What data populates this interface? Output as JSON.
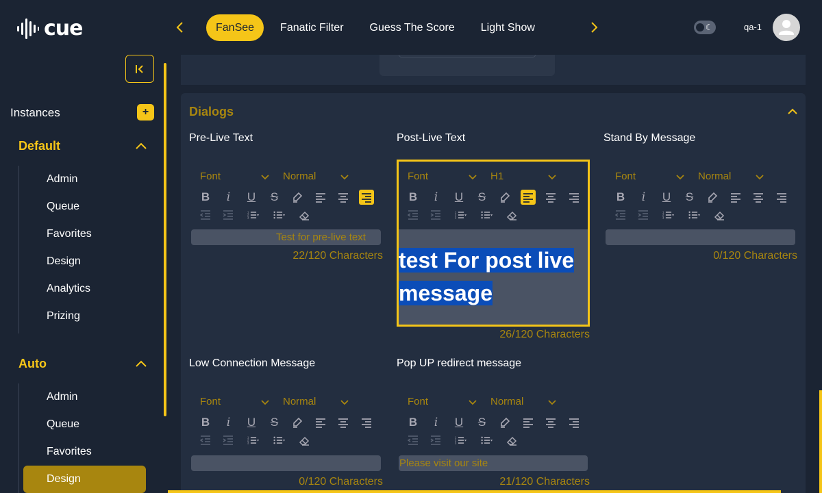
{
  "header": {
    "logo_text": "cue",
    "tabs": [
      {
        "label": "FanSee",
        "active": true
      },
      {
        "label": "Fanatic Filter",
        "active": false
      },
      {
        "label": "Guess The Score",
        "active": false
      },
      {
        "label": "Light Show",
        "active": false
      }
    ],
    "username": "qa-1"
  },
  "sidebar": {
    "instances_label": "Instances",
    "add_label": "+",
    "groups": [
      {
        "title": "Default",
        "items": [
          "Admin",
          "Queue",
          "Favorites",
          "Design",
          "Analytics",
          "Prizing"
        ]
      },
      {
        "title": "Auto",
        "items": [
          "Admin",
          "Queue",
          "Favorites",
          "Design"
        ]
      }
    ],
    "active_item": "Design"
  },
  "dialogs": {
    "title": "Dialogs",
    "fields": [
      {
        "label": "Pre-Live Text",
        "font": "Font",
        "size": "Normal",
        "text": "Test for pre-live text",
        "count": "22/120 Characters"
      },
      {
        "label": "Post-Live Text",
        "font": "Font",
        "size": "H1",
        "text_line1": "test For post live",
        "text_line2": "message",
        "count": "26/120 Characters"
      },
      {
        "label": "Stand By Message",
        "font": "Font",
        "size": "Normal",
        "text": "",
        "count": "0/120 Characters"
      },
      {
        "label": "Low Connection Message",
        "font": "Font",
        "size": "Normal",
        "text": "",
        "count": "0/120 Characters"
      },
      {
        "label": "Pop UP redirect message",
        "font": "Font",
        "size": "Normal",
        "text": "Please visit our site",
        "count": "21/120 Characters"
      }
    ]
  },
  "colors": {
    "accent": "#f5c518",
    "accent_dim": "#a8860f",
    "bg": "#1b2433",
    "panel": "#232e40"
  }
}
